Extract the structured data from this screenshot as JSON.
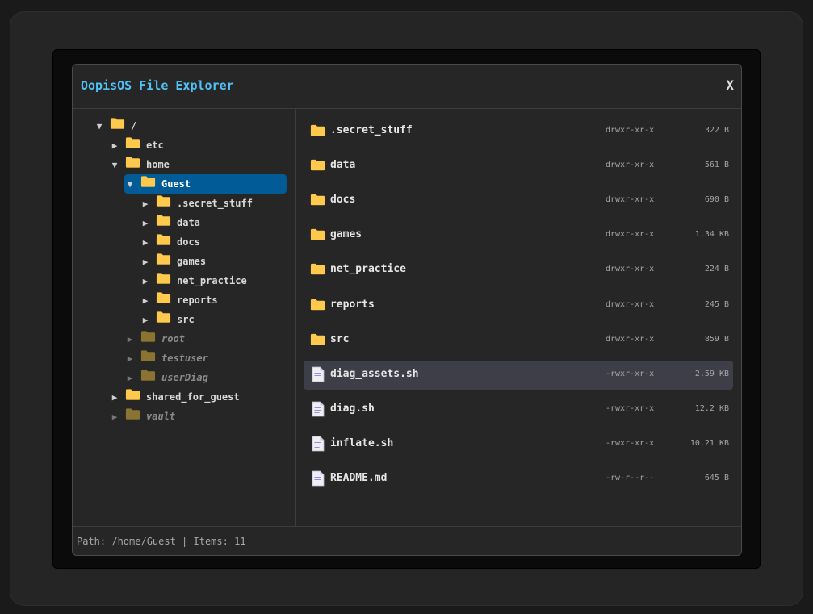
{
  "window": {
    "title": "OopisOS File Explorer",
    "close_label": "X"
  },
  "colors": {
    "accent": "#4fc3f7",
    "selection": "#005b96",
    "folder": "#ffc94d",
    "folder_dim": "#8b7433",
    "row_highlight": "#3e3e48"
  },
  "tree": [
    {
      "label": "/",
      "arrow": "▼",
      "icon": "folder-icon",
      "state": "normal"
    },
    {
      "label": "etc",
      "arrow": "▶",
      "icon": "folder-icon",
      "state": "normal"
    },
    {
      "label": "home",
      "arrow": "▼",
      "icon": "folder-icon",
      "state": "normal"
    },
    {
      "label": "Guest",
      "arrow": "▼",
      "icon": "folder-icon",
      "state": "selected"
    },
    {
      "label": ".secret_stuff",
      "arrow": "▶",
      "icon": "folder-icon",
      "state": "normal"
    },
    {
      "label": "data",
      "arrow": "▶",
      "icon": "folder-icon",
      "state": "normal"
    },
    {
      "label": "docs",
      "arrow": "▶",
      "icon": "folder-icon",
      "state": "normal"
    },
    {
      "label": "games",
      "arrow": "▶",
      "icon": "folder-icon",
      "state": "normal"
    },
    {
      "label": "net_practice",
      "arrow": "▶",
      "icon": "folder-icon",
      "state": "normal"
    },
    {
      "label": "reports",
      "arrow": "▶",
      "icon": "folder-icon",
      "state": "normal"
    },
    {
      "label": "src",
      "arrow": "▶",
      "icon": "folder-icon",
      "state": "normal"
    },
    {
      "label": "root",
      "arrow": "▶",
      "icon": "folder-icon",
      "state": "dim"
    },
    {
      "label": "testuser",
      "arrow": "▶",
      "icon": "folder-icon",
      "state": "dim"
    },
    {
      "label": "userDiag",
      "arrow": "▶",
      "icon": "folder-icon",
      "state": "dim"
    },
    {
      "label": "shared_for_guest",
      "arrow": "▶",
      "icon": "folder-icon",
      "state": "normal"
    },
    {
      "label": "vault",
      "arrow": "▶",
      "icon": "folder-icon",
      "state": "dim"
    }
  ],
  "files": [
    {
      "name": ".secret_stuff",
      "type": "folder",
      "perms": "drwxr-xr-x",
      "size": "322 B"
    },
    {
      "name": "data",
      "type": "folder",
      "perms": "drwxr-xr-x",
      "size": "561 B"
    },
    {
      "name": "docs",
      "type": "folder",
      "perms": "drwxr-xr-x",
      "size": "690 B"
    },
    {
      "name": "games",
      "type": "folder",
      "perms": "drwxr-xr-x",
      "size": "1.34 KB"
    },
    {
      "name": "net_practice",
      "type": "folder",
      "perms": "drwxr-xr-x",
      "size": "224 B"
    },
    {
      "name": "reports",
      "type": "folder",
      "perms": "drwxr-xr-x",
      "size": "245 B"
    },
    {
      "name": "src",
      "type": "folder",
      "perms": "drwxr-xr-x",
      "size": "859 B"
    },
    {
      "name": "diag_assets.sh",
      "type": "file",
      "perms": "-rwxr-xr-x",
      "size": "2.59 KB",
      "highlighted": true
    },
    {
      "name": "diag.sh",
      "type": "file",
      "perms": "-rwxr-xr-x",
      "size": "12.2 KB"
    },
    {
      "name": "inflate.sh",
      "type": "file",
      "perms": "-rwxr-xr-x",
      "size": "10.21 KB"
    },
    {
      "name": "README.md",
      "type": "file",
      "perms": "-rw-r--r--",
      "size": "645 B"
    }
  ],
  "status": {
    "text": "Path: /home/Guest | Items: 11"
  }
}
